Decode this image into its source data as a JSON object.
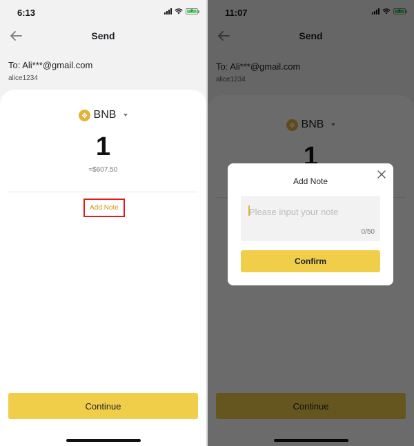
{
  "left_screen": {
    "status": {
      "time": "6:13"
    },
    "nav": {
      "title": "Send"
    },
    "recipient": {
      "to": "To: Ali***@gmail.com",
      "username": "alice1234"
    },
    "asset": {
      "coin": "BNB",
      "amount": "1",
      "fiat_value": "≈$607.50"
    },
    "add_note_label": "Add Note",
    "continue_label": "Continue"
  },
  "right_screen": {
    "status": {
      "time": "11:07"
    },
    "nav": {
      "title": "Send"
    },
    "recipient": {
      "to": "To: Ali***@gmail.com",
      "username": "alice1234"
    },
    "asset": {
      "coin": "BNB",
      "amount": "1"
    },
    "continue_label": "Continue",
    "modal": {
      "title": "Add Note",
      "placeholder": "Please input your note",
      "value": "",
      "counter": "0/50",
      "confirm_label": "Confirm"
    }
  },
  "colors": {
    "accent": "#f1ce4a",
    "coin_gold": "#e0b33b",
    "highlight_box": "#e11b1b",
    "add_note_text": "#c99a13"
  }
}
